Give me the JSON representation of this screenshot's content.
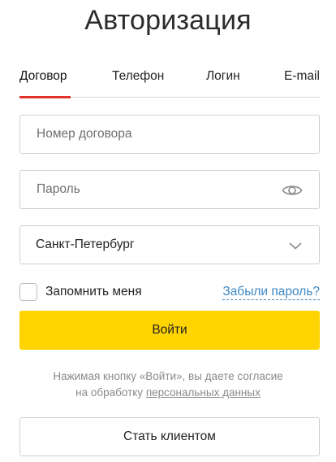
{
  "page": {
    "title": "Авторизация"
  },
  "tabs": [
    {
      "label": "Договор",
      "active": true
    },
    {
      "label": "Телефон",
      "active": false
    },
    {
      "label": "Логин",
      "active": false
    },
    {
      "label": "E-mail",
      "active": false
    }
  ],
  "form": {
    "contract_placeholder": "Номер договора",
    "password_placeholder": "Пароль",
    "city_value": "Санкт-Петербург",
    "remember_label": "Запомнить меня",
    "forgot_label": "Забыли пароль?",
    "login_label": "Войти"
  },
  "consent": {
    "line1": "Нажимая кнопку «Войти», вы даете согласие",
    "line2_prefix": "на обработку ",
    "link": "персональных данных"
  },
  "become_client_label": "Стать клиентом",
  "colors": {
    "accent": "#e3332d",
    "primary_button": "#ffd400",
    "link": "#3d88c4"
  },
  "icons": {
    "password_toggle": "eye-icon",
    "city_select": "chevron-down-icon"
  }
}
